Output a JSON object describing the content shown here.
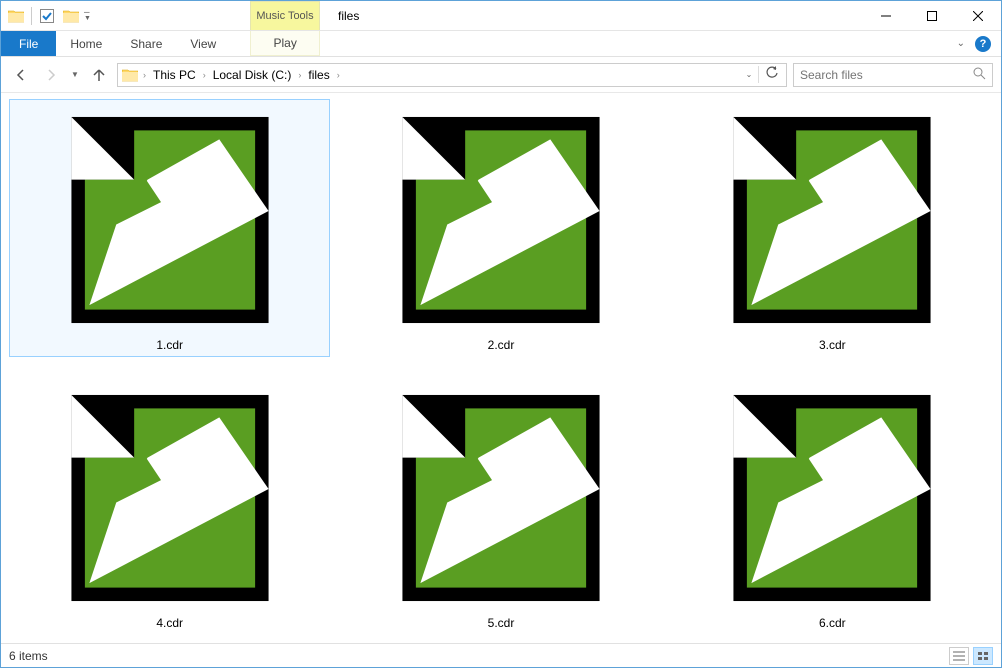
{
  "window": {
    "title": "files",
    "tools_context": "Music Tools"
  },
  "ribbon": {
    "file": "File",
    "tabs": [
      "Home",
      "Share",
      "View"
    ],
    "play": "Play"
  },
  "breadcrumbs": [
    "This PC",
    "Local Disk (C:)",
    "files"
  ],
  "search": {
    "placeholder": "Search files"
  },
  "files": [
    {
      "name": "1.cdr",
      "selected": true
    },
    {
      "name": "2.cdr",
      "selected": false
    },
    {
      "name": "3.cdr",
      "selected": false
    },
    {
      "name": "4.cdr",
      "selected": false
    },
    {
      "name": "5.cdr",
      "selected": false
    },
    {
      "name": "6.cdr",
      "selected": false
    }
  ],
  "status": {
    "items_text": "6 items"
  },
  "icon": {
    "fill": "#5a9e22",
    "outline": "#000000"
  }
}
